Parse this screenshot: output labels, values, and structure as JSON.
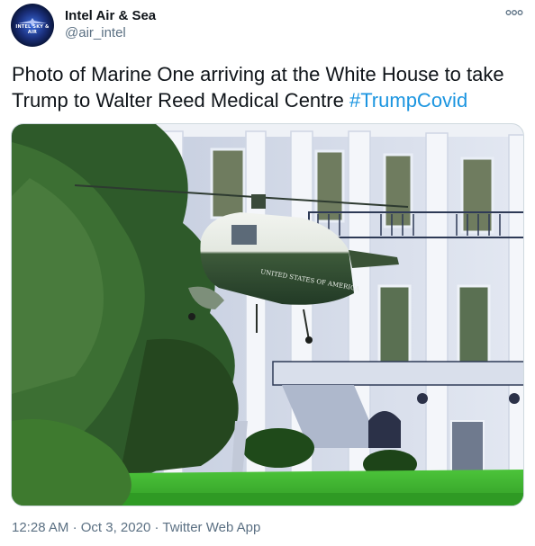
{
  "author": {
    "name": "Intel Air & Sea",
    "handle": "@air_intel",
    "avatar_text": "INTEL SKY & AIR"
  },
  "tweet": {
    "text": "Photo of Marine One arriving at the White House to take Trump to Walter Reed Medical Centre ",
    "hashtag": "#TrumpCovid"
  },
  "media": {
    "helicopter_lettering": "UNITED STATES OF AMERICA"
  },
  "meta": {
    "time": "12:28 AM",
    "separator": "·",
    "date": "Oct 3, 2020",
    "source": "Twitter Web App"
  },
  "icons": {
    "more": "more-icon"
  },
  "colors": {
    "hashtag": "#1b95e0",
    "secondary_text": "#5b7083",
    "primary_text": "#0f1419"
  }
}
